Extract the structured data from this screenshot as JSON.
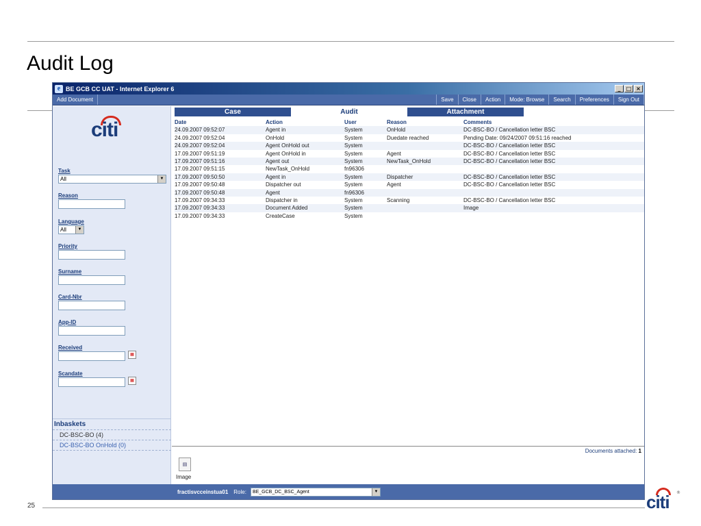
{
  "slide": {
    "title": "Audit Log",
    "page_number": "25",
    "logo_text": "citi"
  },
  "window": {
    "title": "BE GCB CC UAT - Internet Explorer 6",
    "controls": {
      "minimize": "_",
      "maximize": "□",
      "close": "×"
    }
  },
  "toolbar": {
    "add_document": "Add Document",
    "save": "Save",
    "close": "Close",
    "action": "Action",
    "mode": "Mode: Browse",
    "search": "Search",
    "preferences": "Preferences",
    "sign_out": "Sign Out"
  },
  "sidebar": {
    "logo_text": "citi",
    "task": {
      "label": "Task",
      "value": "All"
    },
    "reason": {
      "label": "Reason",
      "value": ""
    },
    "language": {
      "label": "Language",
      "value": "All"
    },
    "priority": {
      "label": "Priority",
      "value": ""
    },
    "surname": {
      "label": "Surname",
      "value": ""
    },
    "card_nbr": {
      "label": "Card-Nbr",
      "value": ""
    },
    "app_id": {
      "label": "App-ID",
      "value": ""
    },
    "received": {
      "label": "Received",
      "value": ""
    },
    "scandate": {
      "label": "Scandate",
      "value": ""
    },
    "inbaskets": {
      "title": "Inbaskets",
      "items": [
        "DC-BSC-BO (4)",
        "DC-BSC-BO OnHold (0)"
      ]
    }
  },
  "tabs": [
    "Case",
    "Audit",
    "Attachment"
  ],
  "audit": {
    "headers": {
      "date": "Date",
      "action": "Action",
      "user": "User",
      "reason": "Reason",
      "comments": "Comments"
    },
    "rows": [
      {
        "date": "24.09.2007 09:52:07",
        "action": "Agent in",
        "user": "System",
        "reason": "OnHold",
        "comments": "DC-BSC-BO / Cancellation letter BSC"
      },
      {
        "date": "24.09.2007 09:52:04",
        "action": "OnHold",
        "user": "System",
        "reason": "Duedate reached",
        "comments": "Pending Date: 09/24/2007 09:51:16 reached"
      },
      {
        "date": "24.09.2007 09:52:04",
        "action": "Agent OnHold out",
        "user": "System",
        "reason": "",
        "comments": "DC-BSC-BO / Cancellation letter BSC"
      },
      {
        "date": "17.09.2007 09:51:19",
        "action": "Agent OnHold in",
        "user": "System",
        "reason": "Agent",
        "comments": "DC-BSC-BO / Cancellation letter BSC"
      },
      {
        "date": "17.09.2007 09:51:16",
        "action": "Agent out",
        "user": "System",
        "reason": "NewTask_OnHold",
        "comments": "DC-BSC-BO / Cancellation letter BSC"
      },
      {
        "date": "17.09.2007 09:51:15",
        "action": "NewTask_OnHold",
        "user": "fn96306",
        "reason": "",
        "comments": ""
      },
      {
        "date": "17.09.2007 09:50:50",
        "action": "Agent in",
        "user": "System",
        "reason": "Dispatcher",
        "comments": "DC-BSC-BO / Cancellation letter BSC"
      },
      {
        "date": "17.09.2007 09:50:48",
        "action": "Dispatcher out",
        "user": "System",
        "reason": "Agent",
        "comments": "DC-BSC-BO / Cancellation letter BSC"
      },
      {
        "date": "17.09.2007 09:50:48",
        "action": "Agent",
        "user": "fn96306",
        "reason": "",
        "comments": ""
      },
      {
        "date": "17.09.2007 09:34:33",
        "action": "Dispatcher in",
        "user": "System",
        "reason": "Scanning",
        "comments": "DC-BSC-BO / Cancellation letter BSC"
      },
      {
        "date": "17.09.2007 09:34:33",
        "action": "Document Added",
        "user": "System",
        "reason": "",
        "comments": "Image"
      },
      {
        "date": "17.09.2007 09:34:33",
        "action": "CreateCase",
        "user": "System",
        "reason": "",
        "comments": ""
      }
    ]
  },
  "attachments": {
    "label": "Documents attached:",
    "count": "1",
    "image_label": "Image"
  },
  "statusbar": {
    "user": "fractisvcceinstua01",
    "role_label": "Role:",
    "role_value": "BE_GCB_DC_BSC_Agent"
  }
}
